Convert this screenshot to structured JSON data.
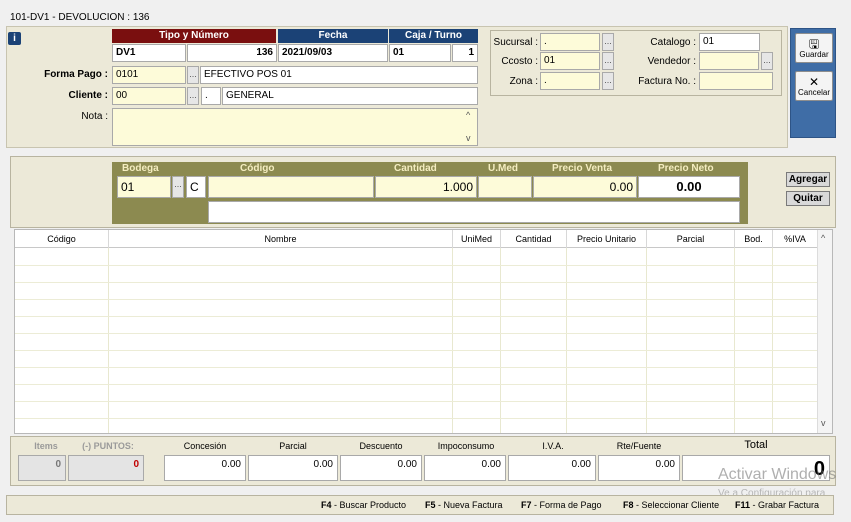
{
  "window": {
    "title": "101-DV1 - DEVOLUCION : 136"
  },
  "header": {
    "tipo_numero_label": "Tipo y Número",
    "fecha_label": "Fecha",
    "caja_turno_label": "Caja / Turno",
    "tipo": "DV1",
    "numero": "136",
    "fecha": "2021/09/03",
    "caja": "01",
    "turno": "1",
    "forma_pago_label": "Forma Pago :",
    "forma_pago_code": "0101",
    "forma_pago_desc": "EFECTIVO POS 01",
    "cliente_label": "Cliente :",
    "cliente_code": "00",
    "cliente_sub": ".",
    "cliente_name": "GENERAL",
    "nota_label": "Nota :",
    "nota_value": ""
  },
  "right_box": {
    "sucursal_label": "Sucursal :",
    "sucursal_value": ".",
    "ccosto_label": "Ccosto :",
    "ccosto_value": "01",
    "zona_label": "Zona :",
    "zona_value": ".",
    "catalogo_label": "Catalogo :",
    "catalogo_value": "01",
    "vendedor_label": "Vendedor :",
    "vendedor_value": "",
    "factura_label": "Factura No. :",
    "factura_value": ""
  },
  "side": {
    "guardar_label": "Guardar",
    "cancelar_label": "Cancelar"
  },
  "entry": {
    "bodega_label": "Bodega",
    "codigo_label": "Código",
    "cantidad_label": "Cantidad",
    "umed_label": "U.Med",
    "precio_venta_label": "Precio Venta",
    "precio_neto_label": "Precio Neto",
    "bodega_value": "01",
    "c_value": "C",
    "codigo_value": "",
    "cantidad_value": "1.000",
    "umed_value": "",
    "precio_venta_value": "0.00",
    "precio_neto_value": "0.00",
    "agregar_label": "Agregar",
    "quitar_label": "Quitar"
  },
  "grid": {
    "columns": [
      "Código",
      "Nombre",
      "UniMed",
      "Cantidad",
      "Precio Unitario",
      "Parcial",
      "Bod.",
      "%IVA"
    ]
  },
  "totals": {
    "items_label": "Items",
    "puntos_label": "(-) PUNTOS:",
    "items_value": "0",
    "puntos_value": "0",
    "concesion_label": "Concesión",
    "concesion_value": "0.00",
    "parcial_label": "Parcial",
    "parcial_value": "0.00",
    "descuento_label": "Descuento",
    "descuento_value": "0.00",
    "impoconsumo_label": "Impoconsumo",
    "impoconsumo_value": "0.00",
    "iva_label": "I.V.A.",
    "iva_value": "0.00",
    "rte_label": "Rte/Fuente",
    "rte_value": "0.00",
    "total_label": "Total",
    "total_value": "0"
  },
  "shortcuts": [
    {
      "key": "F4",
      "label": "- Buscar Producto"
    },
    {
      "key": "F5",
      "label": "- Nueva Factura"
    },
    {
      "key": "F7",
      "label": "- Forma de Pago"
    },
    {
      "key": "F8",
      "label": "- Seleccionar Cliente"
    },
    {
      "key": "F11",
      "label": "- Grabar Factura"
    }
  ],
  "watermark": {
    "line1": "Activar Windows",
    "line2": "Ve a Configuración para"
  },
  "colors": {
    "header_red": "#7a0f0f",
    "header_blue": "#1b4276",
    "olive": "#8c8a50",
    "side_blue": "#3f6da6",
    "puntos_red": "#c00000"
  }
}
